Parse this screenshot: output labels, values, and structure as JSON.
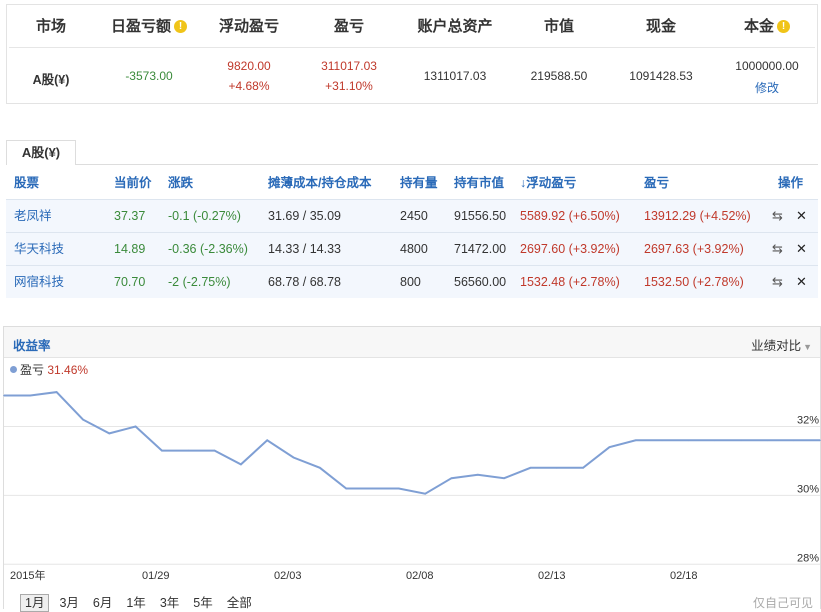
{
  "summary": {
    "headers": {
      "market": "市场",
      "daily_pl": "日盈亏额",
      "float_pl": "浮动盈亏",
      "pl": "盈亏",
      "total_assets": "账户总资产",
      "market_value": "市值",
      "cash": "现金",
      "principal": "本金"
    },
    "info_glyph": "!",
    "market": "A股(¥)",
    "daily_pl": "-3573.00",
    "float_pl": "9820.00",
    "float_pl_pct": "+4.68%",
    "pl": "311017.03",
    "pl_pct": "+31.10%",
    "total_assets": "1311017.03",
    "market_value": "219588.50",
    "cash": "1091428.53",
    "principal": "1000000.00",
    "edit_label": "修改"
  },
  "holdings": {
    "tab_label": "A股(¥)",
    "columns": {
      "stock": "股票",
      "price": "当前价",
      "change": "涨跌",
      "cost": "摊薄成本/持仓成本",
      "qty": "持有量",
      "value": "持有市值",
      "float_pl": "↓浮动盈亏",
      "pl": "盈亏",
      "ops": "操作"
    },
    "rows": [
      {
        "name": "老凤祥",
        "price": "37.37",
        "change": "-0.1 (-0.27%)",
        "cost": "31.69 / 35.09",
        "qty": "2450",
        "value": "91556.50",
        "float_pl": "5589.92 (+6.50%)",
        "pl": "13912.29 (+4.52%)"
      },
      {
        "name": "华天科技",
        "price": "14.89",
        "change": "-0.36 (-2.36%)",
        "cost": "14.33 / 14.33",
        "qty": "4800",
        "value": "71472.00",
        "float_pl": "2697.60 (+3.92%)",
        "pl": "2697.63 (+3.92%)"
      },
      {
        "name": "网宿科技",
        "price": "70.70",
        "change": "-2 (-2.75%)",
        "cost": "68.78 / 68.78",
        "qty": "800",
        "value": "56560.00",
        "float_pl": "1532.48 (+2.78%)",
        "pl": "1532.50 (+2.78%)"
      }
    ]
  },
  "chart_panel": {
    "title": "收益率",
    "compare_label": "业绩对比",
    "legend_label": "盈亏",
    "legend_value": "31.46%",
    "ranges": [
      "1月",
      "3月",
      "6月",
      "1年",
      "3年",
      "5年",
      "全部"
    ],
    "active_range": "1月",
    "corner_note": "仅自己可见"
  },
  "chart_data": {
    "type": "line",
    "series": [
      {
        "name": "盈亏",
        "color": "#7f9fd4",
        "values": [
          32.9,
          32.9,
          33.0,
          32.2,
          31.8,
          32.0,
          31.3,
          31.3,
          31.3,
          30.9,
          31.6,
          31.1,
          30.8,
          30.2,
          30.2,
          30.2,
          30.05,
          30.5,
          30.6,
          30.5,
          30.8,
          30.8,
          30.8,
          31.4,
          31.6,
          31.6,
          31.6,
          31.6,
          31.6,
          31.6,
          31.6,
          31.6
        ]
      }
    ],
    "y_ticks": [
      "32%",
      "30%",
      "28%"
    ],
    "ylim": [
      27.95,
      33.35
    ],
    "x_tick_labels": [
      "2015年",
      "01/29",
      "02/03",
      "02/08",
      "02/13",
      "02/18"
    ],
    "grid": "horizontal"
  }
}
